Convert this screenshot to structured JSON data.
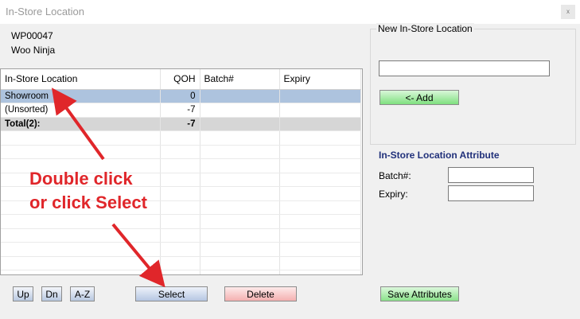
{
  "window": {
    "title": "In-Store Location",
    "close_label": "x"
  },
  "product": {
    "code": "WP00047",
    "name": "Woo Ninja"
  },
  "grid": {
    "columns": [
      "In-Store Location",
      "QOH",
      "Batch#",
      "Expiry"
    ],
    "rows": [
      {
        "location": "Showroom",
        "qoh": "0",
        "batch": "",
        "expiry": ""
      },
      {
        "location": "(Unsorted)",
        "qoh": "-7",
        "batch": "",
        "expiry": ""
      }
    ],
    "total": {
      "label": "Total(2):",
      "qoh": "-7"
    }
  },
  "new_location": {
    "title": "New In-Store Location",
    "value": "",
    "add_label": "<-   Add"
  },
  "attributes": {
    "heading": "In-Store Location Attribute",
    "batch_label": "Batch#:",
    "expiry_label": "Expiry:",
    "batch_value": "",
    "expiry_value": ""
  },
  "buttons": {
    "up": "Up",
    "dn": "Dn",
    "az": "A-Z",
    "select": "Select",
    "delete": "Delete",
    "save": "Save Attributes"
  },
  "annotation": {
    "line1": "Double click",
    "line2": "or click Select",
    "color": "#e0262a"
  }
}
